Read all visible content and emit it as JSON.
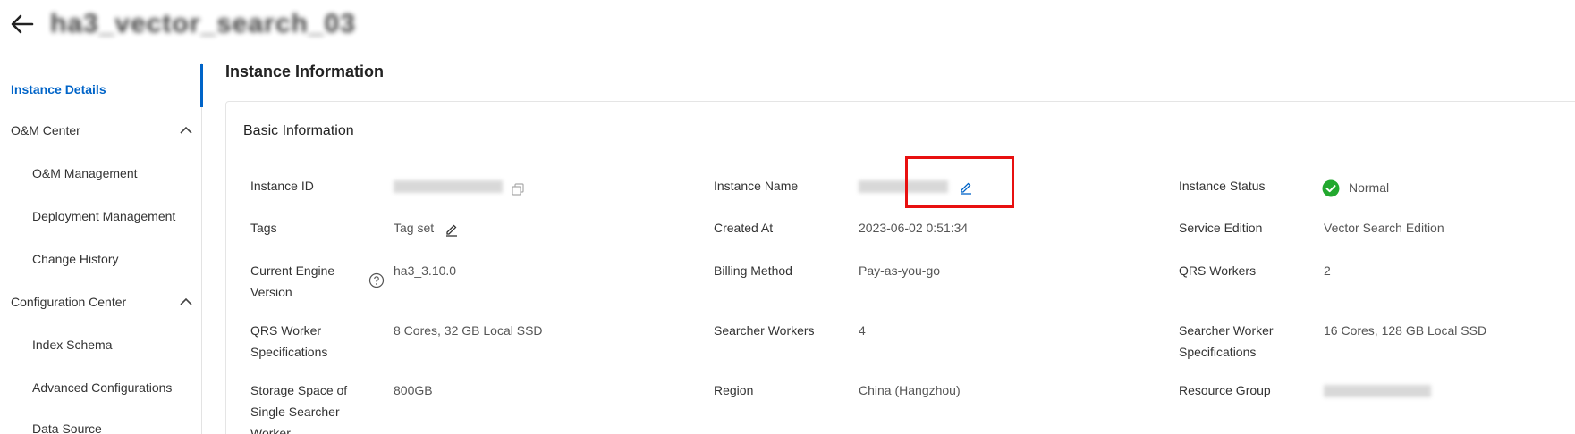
{
  "header": {
    "title": "ha3_vector_search_03"
  },
  "sidebar": {
    "items": [
      {
        "label": "Instance Details",
        "active": true,
        "level": "top"
      },
      {
        "label": "O&M Center",
        "level": "top",
        "expandable": true
      },
      {
        "label": "O&M Management",
        "level": "sub"
      },
      {
        "label": "Deployment Management",
        "level": "sub"
      },
      {
        "label": "Change History",
        "level": "sub"
      },
      {
        "label": "Configuration Center",
        "level": "top",
        "expandable": true
      },
      {
        "label": "Index Schema",
        "level": "sub"
      },
      {
        "label": "Advanced Configurations",
        "level": "sub"
      },
      {
        "label": "Data Source",
        "level": "sub"
      }
    ]
  },
  "main": {
    "title": "Instance Information",
    "card_title": "Basic Information",
    "fields": {
      "instance_id": {
        "label": "Instance ID",
        "value": ""
      },
      "instance_name": {
        "label": "Instance Name",
        "value": ""
      },
      "instance_status": {
        "label": "Instance Status",
        "value": "Normal"
      },
      "tags": {
        "label": "Tags",
        "value": "Tag  set"
      },
      "created_at": {
        "label": "Created At",
        "value": "2023-06-02 0:51:34"
      },
      "service_edition": {
        "label": "Service Edition",
        "value": "Vector Search Edition"
      },
      "engine_version": {
        "label": "Current Engine Version",
        "value": "ha3_3.10.0"
      },
      "billing_method": {
        "label": "Billing Method",
        "value": "Pay-as-you-go"
      },
      "qrs_workers": {
        "label": "QRS Workers",
        "value": "2"
      },
      "qrs_worker_specs": {
        "label": "QRS Worker Specifications",
        "value": "8 Cores, 32 GB Local SSD"
      },
      "searcher_workers": {
        "label": "Searcher Workers",
        "value": "4"
      },
      "searcher_worker_specs": {
        "label": "Searcher Worker Specifications",
        "value": "16 Cores, 128 GB Local SSD"
      },
      "storage_space": {
        "label": "Storage Space of Single Searcher Worker",
        "value": "800GB"
      },
      "region": {
        "label": "Region",
        "value": "China (Hangzhou)"
      },
      "resource_group": {
        "label": "Resource Group",
        "value": ""
      }
    }
  },
  "colors": {
    "accent": "#0064c8",
    "status_ok": "#22a82e",
    "highlight": "#e81010"
  },
  "icons": {
    "back": "arrow-left-icon",
    "chevron": "chevron-up-icon",
    "edit": "pencil-icon",
    "copy": "copy-icon",
    "help": "question-circle-icon",
    "status": "check-circle-icon"
  }
}
